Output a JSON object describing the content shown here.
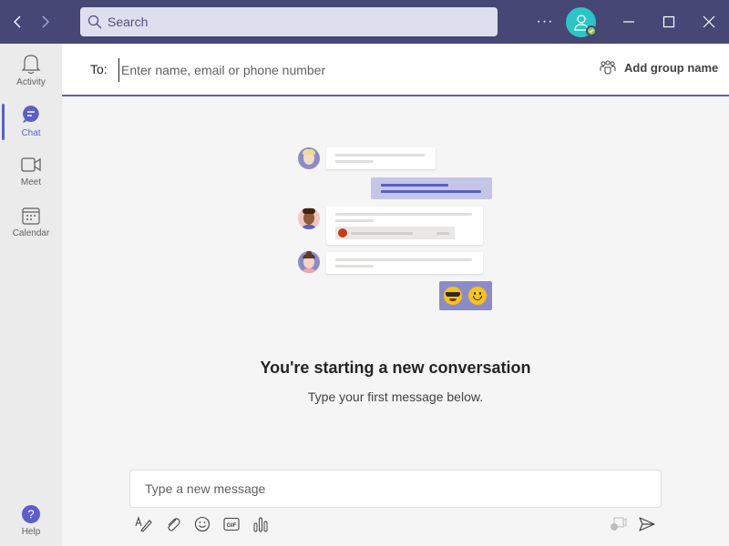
{
  "titlebar": {
    "back_icon": "chevron-left-icon",
    "forward_icon": "chevron-right-icon",
    "search_placeholder": "Search",
    "more_label": "···",
    "presence_status": "available",
    "colors": {
      "bar": "#464775",
      "search_bg": "#dedfee",
      "avatar": "#2bc5c5",
      "presence": "#92c353"
    }
  },
  "rail": {
    "items": [
      {
        "label": "Activity",
        "icon": "bell-icon",
        "active": false
      },
      {
        "label": "Chat",
        "icon": "chat-icon",
        "active": true
      },
      {
        "label": "Meet",
        "icon": "video-icon",
        "active": false
      },
      {
        "label": "Calendar",
        "icon": "calendar-icon",
        "active": false
      }
    ],
    "help": {
      "label": "Help",
      "icon": "help-icon"
    },
    "accent": "#5b5fc7"
  },
  "header": {
    "to_label": "To:",
    "to_placeholder": "Enter name, email or phone number",
    "add_group_label": "Add group name"
  },
  "empty_state": {
    "title": "You're starting a new conversation",
    "subtitle": "Type your first message below."
  },
  "compose": {
    "placeholder": "Type a new message",
    "tools": [
      {
        "name": "format-icon"
      },
      {
        "name": "attach-icon"
      },
      {
        "name": "emoji-icon"
      },
      {
        "name": "gif-icon",
        "label": "GIF"
      },
      {
        "name": "poll-icon"
      }
    ],
    "loop_icon": "loop-icon",
    "send_icon": "send-icon"
  }
}
